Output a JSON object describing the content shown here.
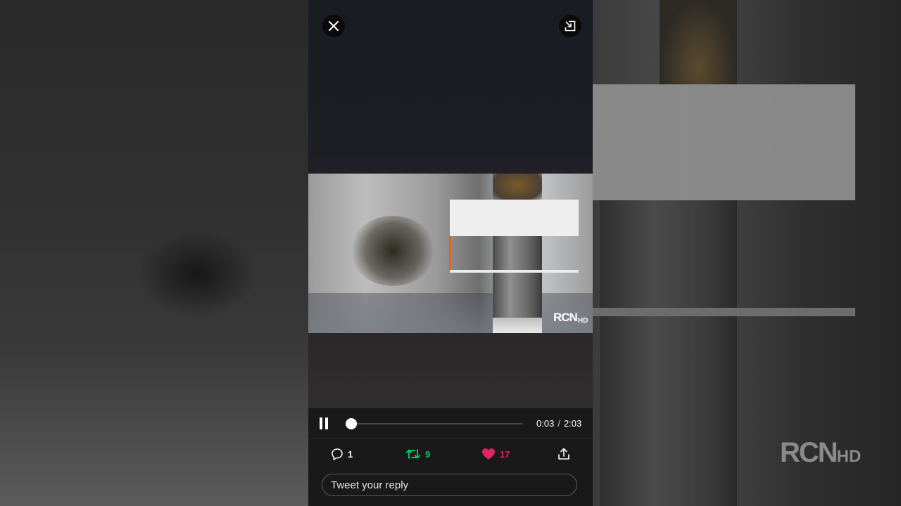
{
  "backdrop": {
    "logo_main": "RCN",
    "logo_hd": "HD"
  },
  "player": {
    "close_label": "Close",
    "pip_label": "Pop out",
    "video": {
      "logo_main": "RCN",
      "logo_hd": "HD"
    },
    "controls": {
      "state": "playing",
      "progress_fraction": 0.024,
      "current_time": "0:03",
      "separator": "/",
      "duration": "2:03"
    }
  },
  "actions": {
    "reply_count": "1",
    "retweet_count": "9",
    "like_count": "17",
    "colors": {
      "retweet": "#17bf63",
      "like": "#e0245e"
    }
  },
  "reply": {
    "placeholder": "Tweet your reply"
  }
}
